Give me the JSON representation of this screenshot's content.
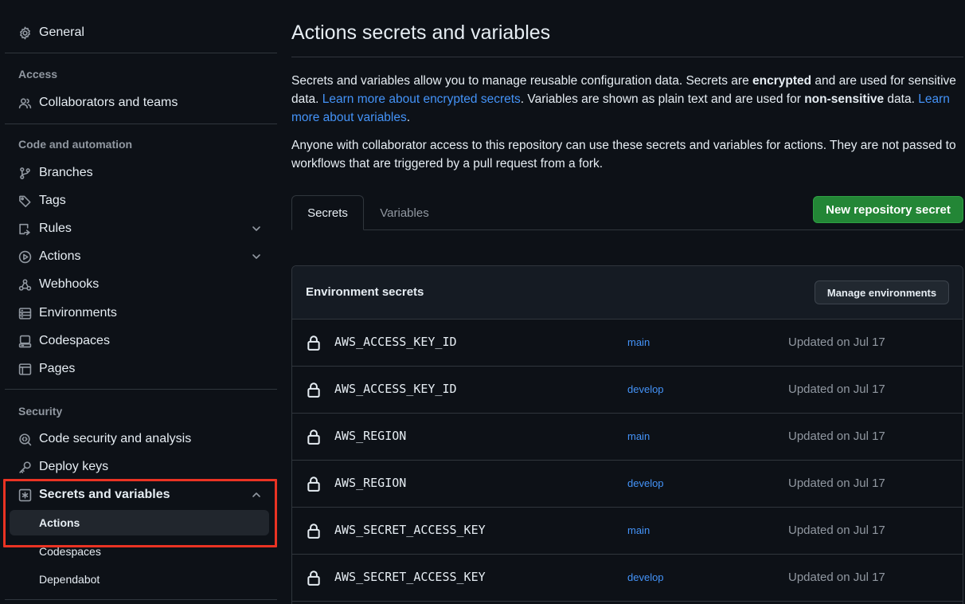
{
  "sidebar": {
    "general": "General",
    "access_heading": "Access",
    "collaborators": "Collaborators and teams",
    "code_heading": "Code and automation",
    "branches": "Branches",
    "tags": "Tags",
    "rules": "Rules",
    "actions": "Actions",
    "webhooks": "Webhooks",
    "environments": "Environments",
    "codespaces": "Codespaces",
    "pages": "Pages",
    "security_heading": "Security",
    "code_security": "Code security and analysis",
    "deploy_keys": "Deploy keys",
    "secrets_variables": "Secrets and variables",
    "sub_items": [
      "Actions",
      "Codespaces",
      "Dependabot"
    ],
    "highlight_color": "#ea3323"
  },
  "main": {
    "title": "Actions secrets and variables",
    "desc1": {
      "t1": "Secrets and variables allow you to manage reusable configuration data. Secrets are ",
      "b1": "encrypted",
      "t2": " and are used for sensitive data. ",
      "link1": "Learn more about encrypted secrets",
      "t3": ". Variables are shown as plain text and are used for ",
      "b2": "non-sensitive",
      "t4": " data. ",
      "link2": "Learn more about variables",
      "t5": "."
    },
    "desc2": "Anyone with collaborator access to this repository can use these secrets and variables for actions. They are not passed to workflows that are triggered by a pull request from a fork.",
    "tabs": [
      "Secrets",
      "Variables"
    ],
    "new_secret_button": "New repository secret",
    "env_secrets_title": "Environment secrets",
    "manage_environments_button": "Manage environments",
    "secrets": [
      {
        "name": "AWS_ACCESS_KEY_ID",
        "env": "main",
        "updated": "Updated on Jul 17"
      },
      {
        "name": "AWS_ACCESS_KEY_ID",
        "env": "develop",
        "updated": "Updated on Jul 17"
      },
      {
        "name": "AWS_REGION",
        "env": "main",
        "updated": "Updated on Jul 17"
      },
      {
        "name": "AWS_REGION",
        "env": "develop",
        "updated": "Updated on Jul 17"
      },
      {
        "name": "AWS_SECRET_ACCESS_KEY",
        "env": "main",
        "updated": "Updated on Jul 17"
      },
      {
        "name": "AWS_SECRET_ACCESS_KEY",
        "env": "develop",
        "updated": "Updated on Jul 17"
      }
    ],
    "colors": {
      "background": "#0d1117",
      "link": "#4493f8",
      "primary_button": "#238636",
      "muted_text": "#9198a1",
      "border": "#30363d"
    }
  }
}
